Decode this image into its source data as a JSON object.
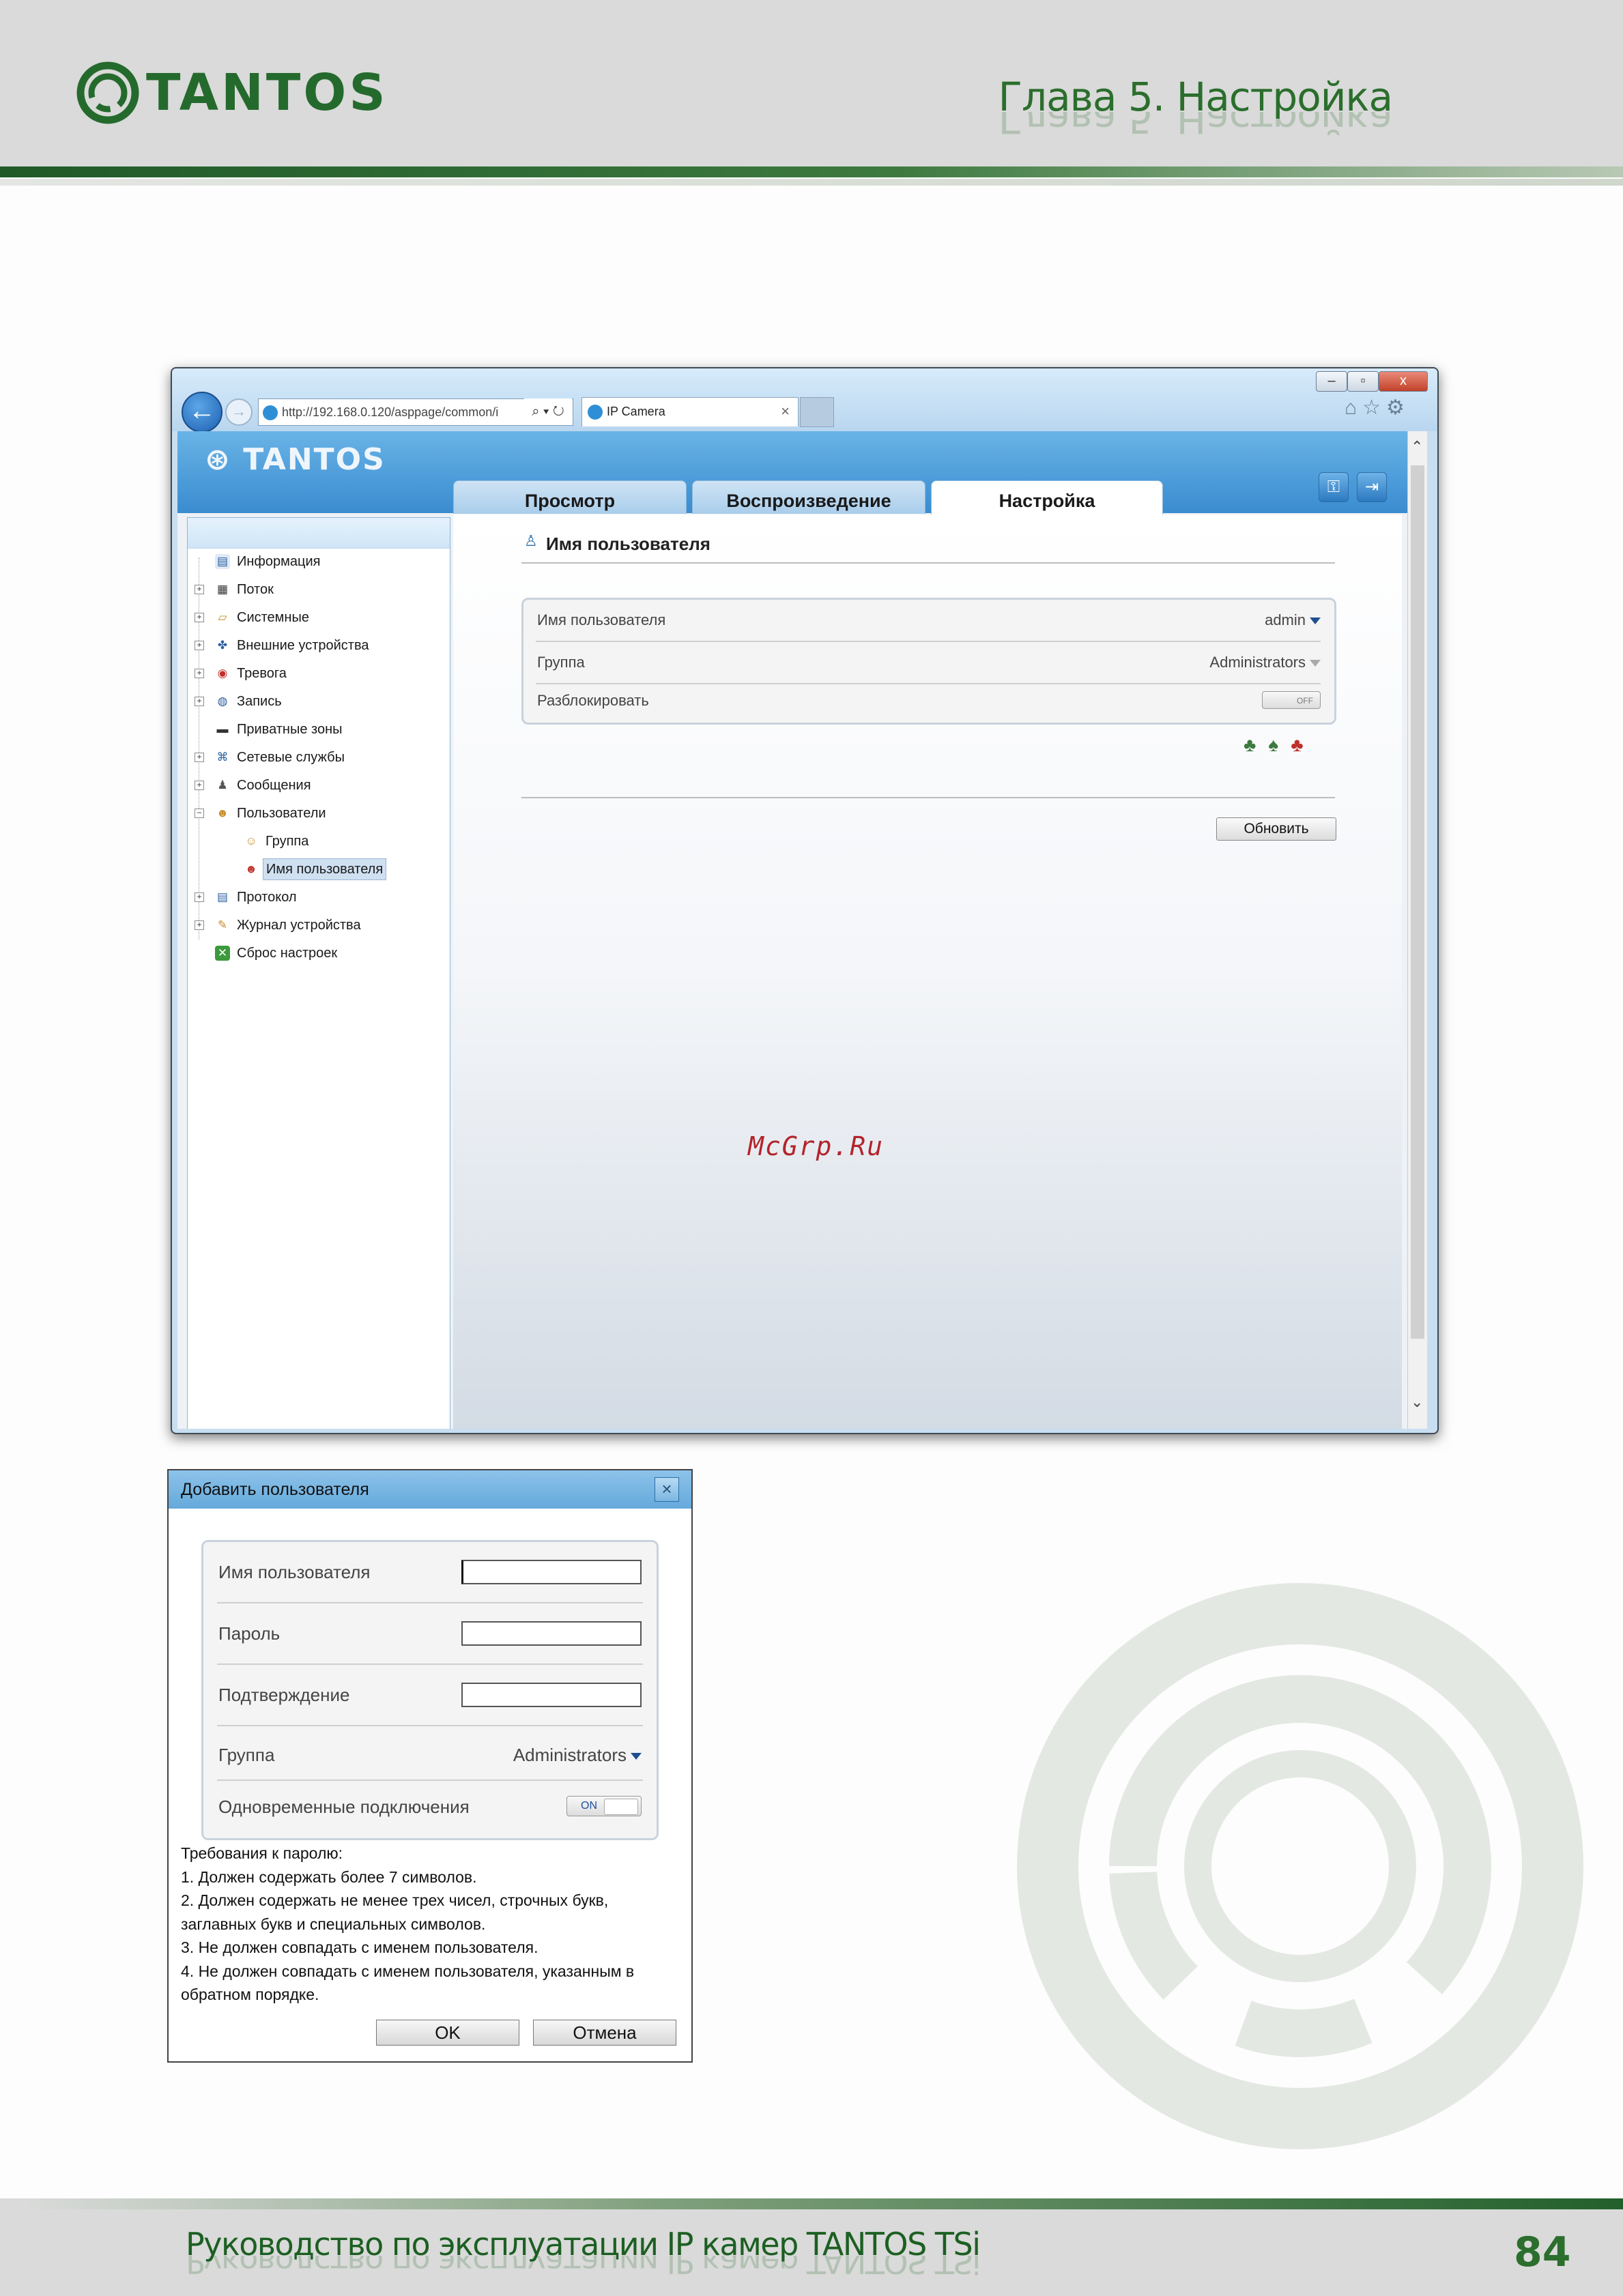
{
  "page": {
    "logo_text": "TANTOS",
    "chapter_title": "Глава 5. Настройка",
    "footer_title": "Руководство по эксплуатации IP камер TANTOS TSi",
    "page_number": "84",
    "watermark": "McGrp.Ru",
    "colors": {
      "brand_green": "#2b6e2d",
      "header_gray": "#d9dad9"
    }
  },
  "browser": {
    "window_buttons": {
      "minimize": "–",
      "maximize": "▫",
      "close": "x"
    },
    "address": "http://192.168.0.120/asppage/common/i",
    "address_tools": "⌕ ▾ ↻",
    "tab_title": "IP Camera",
    "tab_close": "×",
    "toolbar_icons": "⌂☆⚙"
  },
  "app": {
    "logo_text": "TANTOS",
    "tabs": [
      {
        "label": "Просмотр"
      },
      {
        "label": "Воспроизведение"
      },
      {
        "label": "Настройка",
        "active": true
      }
    ],
    "header_icons": [
      "key-icon",
      "logout-icon"
    ],
    "sidebar": {
      "items": [
        {
          "label": "Информация",
          "icon": "info-icon",
          "expandable": false
        },
        {
          "label": "Поток",
          "icon": "stream-icon",
          "expandable": true
        },
        {
          "label": "Системные",
          "icon": "system-icon",
          "expandable": true
        },
        {
          "label": "Внешние устройства",
          "icon": "external-devices-icon",
          "expandable": true
        },
        {
          "label": "Тревога",
          "icon": "alarm-icon",
          "expandable": true
        },
        {
          "label": "Запись",
          "icon": "record-icon",
          "expandable": true
        },
        {
          "label": "Приватные зоны",
          "icon": "privacy-icon",
          "expandable": false
        },
        {
          "label": "Сетевые службы",
          "icon": "network-icon",
          "expandable": true
        },
        {
          "label": "Сообщения",
          "icon": "messages-icon",
          "expandable": true
        },
        {
          "label": "Пользователи",
          "icon": "users-icon",
          "expandable": true,
          "expanded": true
        },
        {
          "label": "Группа",
          "icon": "group-icon",
          "child": true
        },
        {
          "label": "Имя пользователя",
          "icon": "user-icon",
          "child": true,
          "selected": true
        },
        {
          "label": "Протокол",
          "icon": "protocol-icon",
          "expandable": true
        },
        {
          "label": "Журнал устройства",
          "icon": "log-icon",
          "expandable": true
        },
        {
          "label": "Сброс настроек",
          "icon": "reset-icon",
          "expandable": false
        }
      ]
    },
    "content": {
      "title": "Имя пользователя",
      "rows": {
        "username_label": "Имя пользователя",
        "username_value": "admin",
        "group_label": "Группа",
        "group_value": "Administrators",
        "unlock_label": "Разблокировать",
        "unlock_toggle": "OFF"
      },
      "action_icons": [
        "add-user-icon",
        "edit-user-icon",
        "delete-user-icon"
      ],
      "refresh_button": "Обновить"
    }
  },
  "dialog": {
    "title": "Добавить пользователя",
    "close": "×",
    "fields": {
      "username_label": "Имя пользователя",
      "username_value": "",
      "password_label": "Пароль",
      "password_value": "",
      "confirm_label": "Подтверждение",
      "confirm_value": "",
      "group_label": "Группа",
      "group_value": "Administrators",
      "simultaneous_label": "Одновременные подключения",
      "simultaneous_toggle": "ON"
    },
    "requirements": [
      "Требования к паролю:",
      "1. Должен содержать более 7 символов.",
      "2. Должен содержать не менее трех чисел, строчных букв,",
      "заглавных букв и специальных символов.",
      "3. Не должен совпадать с именем пользователя.",
      "4. Не должен совпадать с именем пользователя, указанным в",
      "обратном порядке."
    ],
    "ok_button": "OK",
    "cancel_button": "Отмена"
  }
}
